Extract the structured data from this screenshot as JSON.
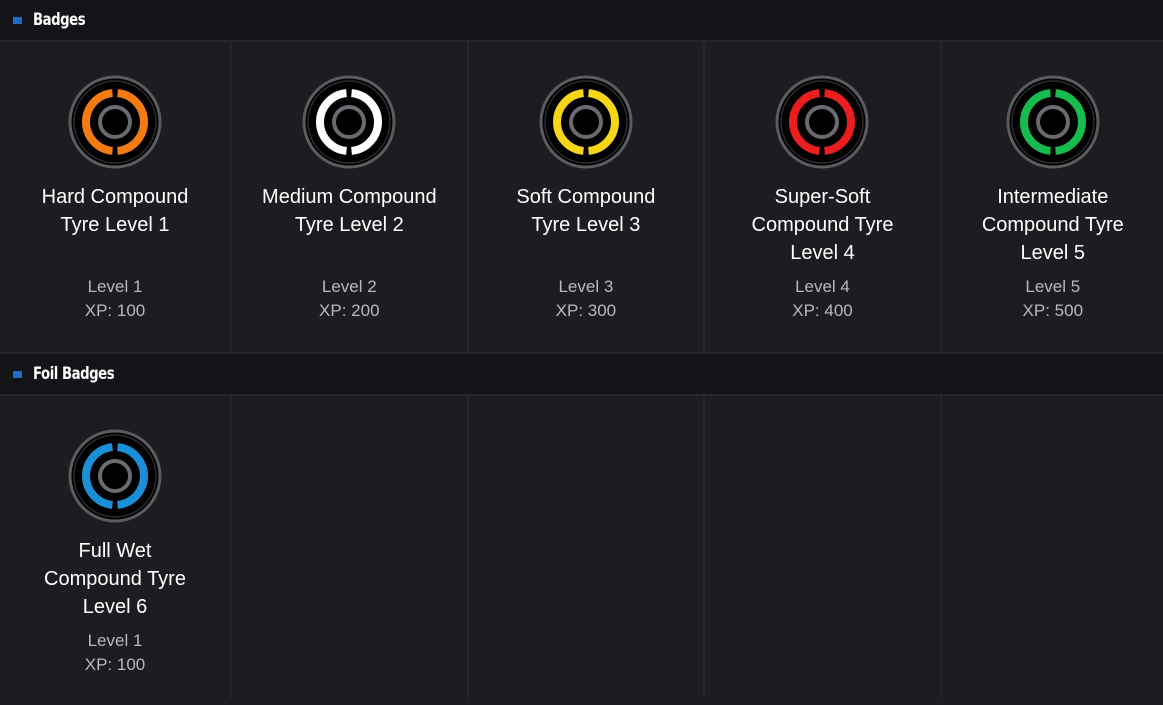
{
  "sections": [
    {
      "title": "Badges",
      "badges": [
        {
          "name": "Hard Compound Tyre Level 1",
          "level": "Level 1",
          "xp": "XP: 100",
          "color": "#f47a12",
          "icon": "tyre-badge-icon"
        },
        {
          "name": "Medium Compound Tyre Level 2",
          "level": "Level 2",
          "xp": "XP: 200",
          "color": "#ffffff",
          "icon": "tyre-badge-icon"
        },
        {
          "name": "Soft Compound Tyre Level 3",
          "level": "Level 3",
          "xp": "XP: 300",
          "color": "#f7d617",
          "icon": "tyre-badge-icon"
        },
        {
          "name": "Super-Soft Compound Tyre Level 4",
          "level": "Level 4",
          "xp": "XP: 400",
          "color": "#ea1e1e",
          "icon": "tyre-badge-icon"
        },
        {
          "name": "Intermediate Compound Tyre Level 5",
          "level": "Level 5",
          "xp": "XP: 500",
          "color": "#16bd4e",
          "icon": "tyre-badge-icon"
        }
      ]
    },
    {
      "title": "Foil Badges",
      "badges": [
        {
          "name": "Full Wet Compound Tyre Level 6",
          "level": "Level 1",
          "xp": "XP: 100",
          "color": "#1a8ed6",
          "icon": "tyre-badge-icon"
        }
      ]
    }
  ],
  "colors": {
    "accent": "#1e6cc4",
    "background": "#1c1d21",
    "header_background": "#131418",
    "grid_line": "#26272c"
  }
}
